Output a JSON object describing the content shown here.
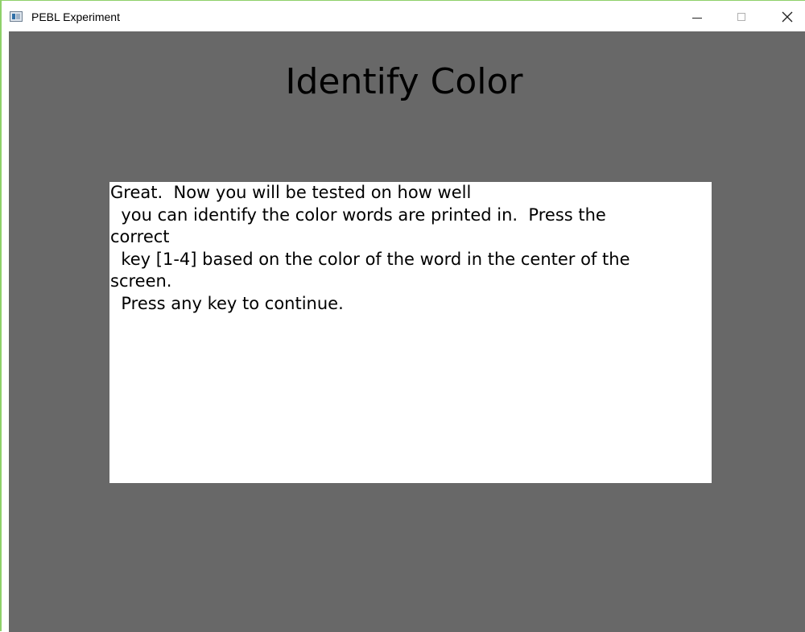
{
  "window": {
    "title": "PEBL Experiment",
    "icon": "app-window-icon",
    "controls": {
      "minimize": "minimize-icon",
      "maximize": "maximize-icon",
      "close": "close-icon"
    }
  },
  "screen": {
    "background": "#686868",
    "heading": "Identify Color",
    "message_lines": [
      "Great.  Now you will be tested on how well",
      "  you can identify the color words are printed in.  Press the",
      "correct",
      "  key [1-4] based on the color of the word in the center of the",
      "screen.",
      "  Press any key to continue."
    ]
  }
}
